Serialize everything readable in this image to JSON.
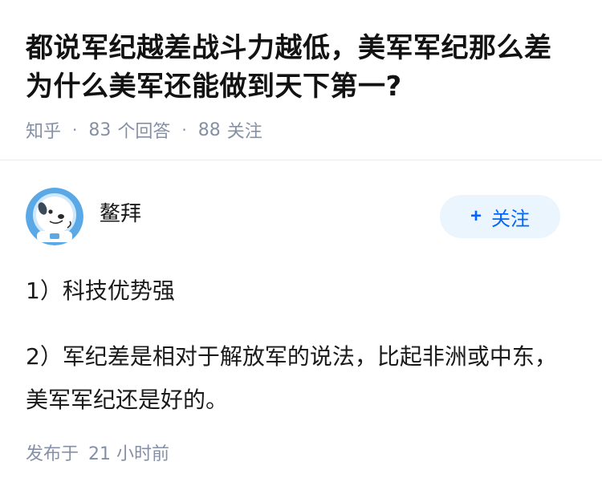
{
  "question": {
    "title": "都说军纪越差战斗力越低，美军军纪那么差为什么美军还能做到天下第一?",
    "source": "知乎",
    "answer_count": "83",
    "answer_label": "个回答",
    "follower_count": "88",
    "follower_label": "关注"
  },
  "answer": {
    "author_name": "鳌拜",
    "follow_button": {
      "icon": "+",
      "label": "关注"
    },
    "paragraphs": [
      "1）科技优势强",
      "2）军纪差是相对于解放军的说法，比起非洲或中东，美军军纪还是好的。"
    ],
    "published_label": "发布于",
    "published_time": "21 小时前"
  },
  "colors": {
    "accent": "#0066ff",
    "button_bg": "#ebf5fd",
    "meta_text": "#8590a6",
    "avatar_bg": "#5aa9e6"
  }
}
